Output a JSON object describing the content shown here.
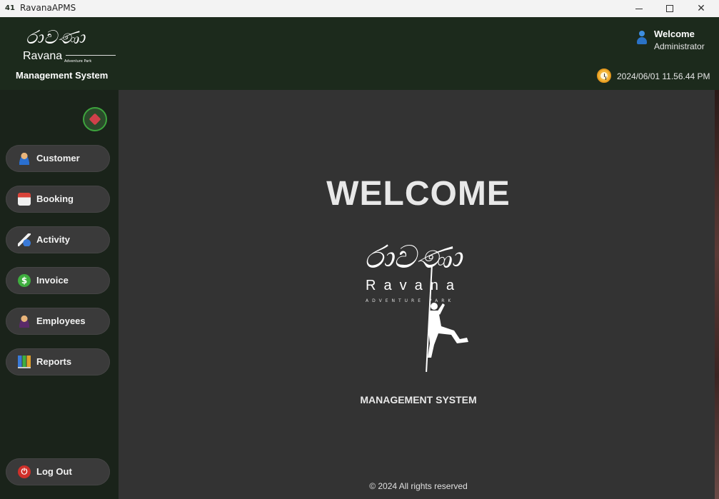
{
  "window": {
    "title": "RavanaAPMS",
    "icon": "app-icon",
    "icon_text": "41"
  },
  "header": {
    "logo_script": "රාවණා",
    "logo_name": "Ravana",
    "logo_tagline": "Adventure Park",
    "app_subtitle": "Management System",
    "welcome_text": "Welcome",
    "user_role": "Administrator",
    "datetime": "2024/06/01 11.56.44 PM"
  },
  "sidebar": {
    "items": [
      {
        "label": "Customer",
        "icon": "customer-icon"
      },
      {
        "label": "Booking",
        "icon": "calendar-icon"
      },
      {
        "label": "Activity",
        "icon": "bowling-icon"
      },
      {
        "label": "Invoice",
        "icon": "dollar-icon"
      },
      {
        "label": "Employees",
        "icon": "employee-icon"
      },
      {
        "label": "Reports",
        "icon": "bar-chart-icon"
      }
    ],
    "logout_label": "Log Out",
    "invoice_glyph": "$",
    "logout_glyph": "⏻"
  },
  "main": {
    "heading": "WELCOME",
    "logo_script": "රාවණා",
    "logo_name": "Ravana",
    "logo_tagline": "ADVENTURE PARK",
    "subtitle": "MANAGEMENT SYSTEM",
    "footer": "© 2024 All rights reserved"
  },
  "colors": {
    "header_bg": "#1c2a1c",
    "sidebar_bg": "#1a231a",
    "main_bg": "#333333",
    "nav_button_bg": "#3a3a3a",
    "pin_accent": "#3da43d"
  }
}
